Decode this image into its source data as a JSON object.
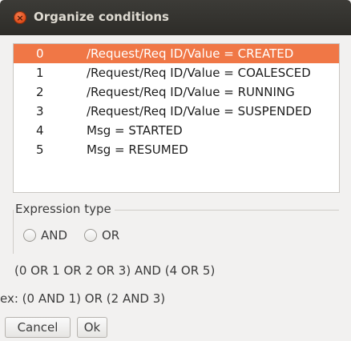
{
  "window": {
    "title": "Organize conditions",
    "close_glyph": "×"
  },
  "conditions": [
    {
      "index": "0",
      "text": "/Request/Req ID/Value = CREATED",
      "selected": true
    },
    {
      "index": "1",
      "text": "/Request/Req ID/Value = COALESCED",
      "selected": false
    },
    {
      "index": "2",
      "text": "/Request/Req ID/Value = RUNNING",
      "selected": false
    },
    {
      "index": "3",
      "text": "/Request/Req ID/Value = SUSPENDED",
      "selected": false
    },
    {
      "index": "4",
      "text": "Msg = STARTED",
      "selected": false
    },
    {
      "index": "5",
      "text": "Msg = RESUMED",
      "selected": false
    }
  ],
  "expression_type": {
    "title": "Expression type",
    "options": [
      "AND",
      "OR"
    ],
    "selected": null
  },
  "expression": "(0 OR 1 OR 2 OR 3) AND (4 OR 5)",
  "example": "ex: (0 AND 1) OR (2 AND 3)",
  "buttons": {
    "cancel": "Cancel",
    "ok": "Ok"
  },
  "colors": {
    "selection": "#f07746",
    "titlebar": "#3c3b37",
    "close_button": "#dd4814"
  }
}
